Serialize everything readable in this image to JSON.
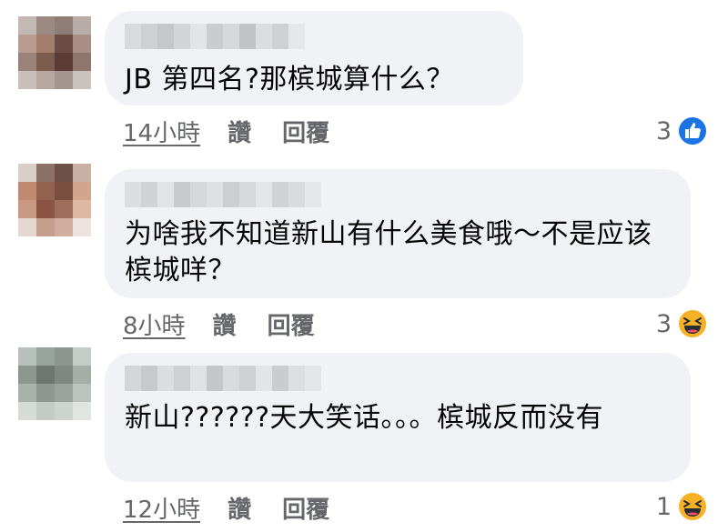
{
  "comments": [
    {
      "text": "JB 第四名?那槟城算什么？",
      "time": "14小時",
      "like_label": "讚",
      "reply_label": "回覆",
      "reaction_count": "3",
      "reaction_icon": "like-icon",
      "avatar_colors": [
        "#c2b9b4",
        "#9c8a82",
        "#8e7d76",
        "#b8aca8",
        "#b79c8f",
        "#a37d6e",
        "#6b4d44",
        "#a88e85",
        "#9a8378",
        "#7d5c50",
        "#5a3c35",
        "#8f766c",
        "#c8bfbb",
        "#b7a9a2",
        "#a5958f",
        "#c9c2bf"
      ]
    },
    {
      "text": "为啥我不知道新山有什么美食哦～不是应该槟城咩？",
      "time": "8小時",
      "like_label": "讚",
      "reply_label": "回覆",
      "reaction_count": "3",
      "reaction_icon": "haha-icon",
      "avatar_colors": [
        "#d8cfcb",
        "#8a7268",
        "#6e5146",
        "#c9b2a5",
        "#c08a72",
        "#93614e",
        "#7b4f3f",
        "#d3a58e",
        "#c89884",
        "#8a5544",
        "#a06e5c",
        "#deb8a3",
        "#e3d7d1",
        "#c79e8c",
        "#cfae9f",
        "#ece3de"
      ]
    },
    {
      "text": "新山??????天大笑话。。。槟城反而没有",
      "time": "12小時",
      "like_label": "讚",
      "reply_label": "回覆",
      "reaction_count": "1",
      "reaction_icon": "haha-icon",
      "avatar_colors": [
        "#b8c0bd",
        "#9aa49e",
        "#8c958f",
        "#c5cbc7",
        "#8d978f",
        "#6d776f",
        "#7e8780",
        "#a5ada7",
        "#a9b1ab",
        "#8f9890",
        "#9aa29c",
        "#bcc3be",
        "#d6dbd8",
        "#c4cac6",
        "#cdd3cf",
        "#e1e5e2"
      ]
    }
  ],
  "colors": {
    "bubble": "#f0f2f5",
    "text": "#050505",
    "meta": "#65676b",
    "like_blue": "#1b74e4",
    "haha_yellow": "#f7b125"
  }
}
